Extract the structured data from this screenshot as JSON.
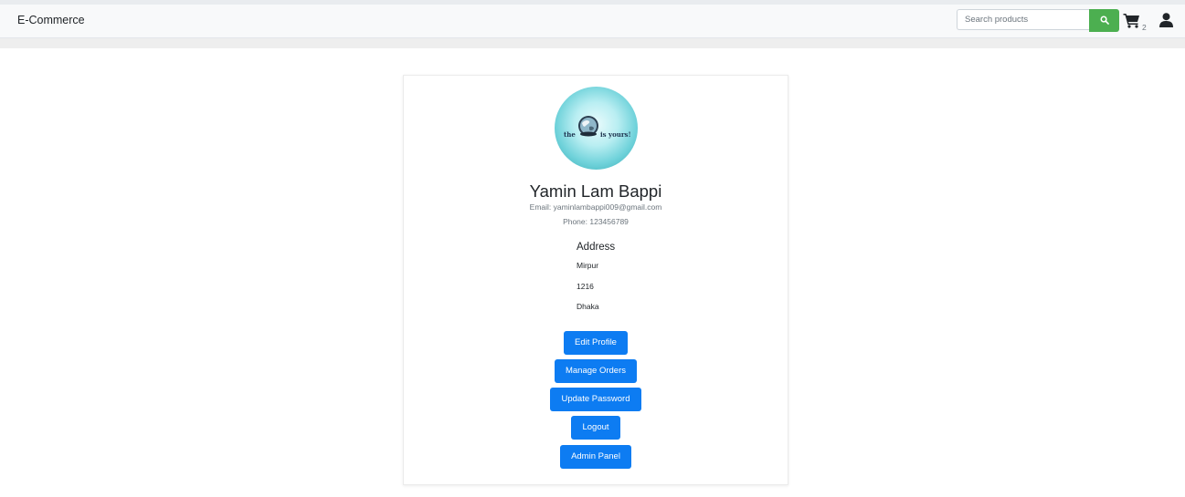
{
  "navbar": {
    "brand": "E-Commerce",
    "search_placeholder": "Search products",
    "cart_count": "2"
  },
  "profile": {
    "name": "Yamin Lam Bappi",
    "email": "Email: yaminlambappi009@gmail.com",
    "phone": "Phone: 123456789",
    "avatar_text_left": "the",
    "avatar_text_right": "is yours!",
    "address_title": "Address",
    "address_lines": [
      "Mirpur",
      "1216",
      "Dhaka"
    ]
  },
  "actions": {
    "edit_profile": "Edit Profile",
    "manage_orders": "Manage Orders",
    "update_password": "Update Password",
    "logout": "Logout",
    "admin_panel": "Admin Panel"
  },
  "colors": {
    "primary_button": "#0d7cf2",
    "search_button": "#4caf50",
    "navbar_bg": "#f8f9fa"
  }
}
